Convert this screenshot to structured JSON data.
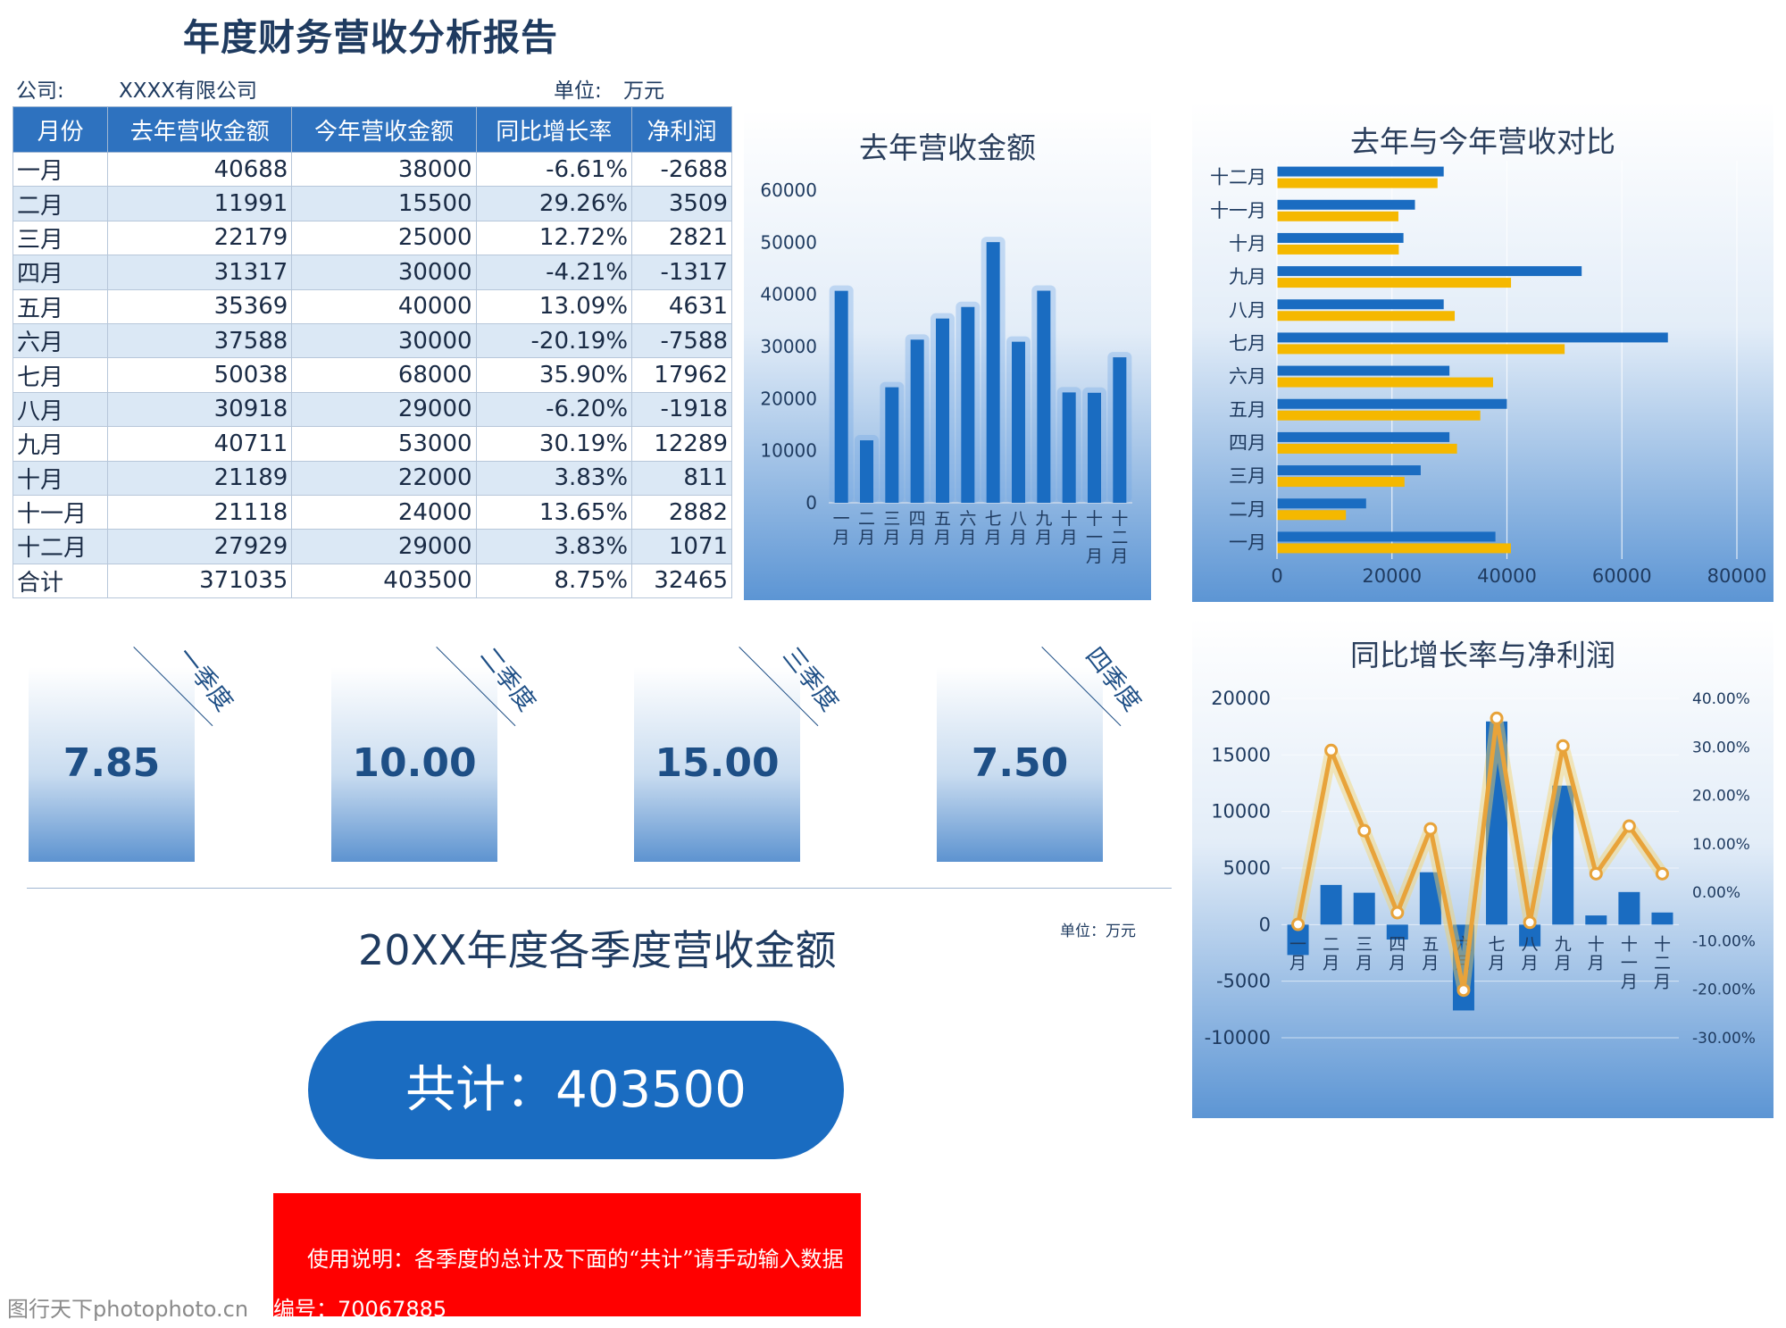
{
  "report": {
    "title": "年度财务营收分析报告",
    "company_label": "公司:",
    "company_value": "XXXX有限公司",
    "unit_label": "单位:",
    "unit_value": "万元"
  },
  "table": {
    "headers": [
      "月份",
      "去年营收金额",
      "今年营收金额",
      "同比增长率",
      "净利润"
    ],
    "rows": [
      [
        "一月",
        "40688",
        "38000",
        "-6.61%",
        "-2688"
      ],
      [
        "二月",
        "11991",
        "15500",
        "29.26%",
        "3509"
      ],
      [
        "三月",
        "22179",
        "25000",
        "12.72%",
        "2821"
      ],
      [
        "四月",
        "31317",
        "30000",
        "-4.21%",
        "-1317"
      ],
      [
        "五月",
        "35369",
        "40000",
        "13.09%",
        "4631"
      ],
      [
        "六月",
        "37588",
        "30000",
        "-20.19%",
        "-7588"
      ],
      [
        "七月",
        "50038",
        "68000",
        "35.90%",
        "17962"
      ],
      [
        "八月",
        "30918",
        "29000",
        "-6.20%",
        "-1918"
      ],
      [
        "九月",
        "40711",
        "53000",
        "30.19%",
        "12289"
      ],
      [
        "十月",
        "21189",
        "22000",
        "3.83%",
        "811"
      ],
      [
        "十一月",
        "21118",
        "24000",
        "13.65%",
        "2882"
      ],
      [
        "十二月",
        "27929",
        "29000",
        "3.83%",
        "1071"
      ],
      [
        "合计",
        "371035",
        "403500",
        "8.75%",
        "32465"
      ]
    ]
  },
  "quarters": [
    {
      "label": "一季度",
      "value": "7.85"
    },
    {
      "label": "二季度",
      "value": "10.00"
    },
    {
      "label": "三季度",
      "value": "15.00"
    },
    {
      "label": "四季度",
      "value": "7.50"
    }
  ],
  "quarter_section": {
    "title": "20XX年度各季度营收金额",
    "unit": "单位：万元",
    "total_text": "共计：403500"
  },
  "note": {
    "text": "使用说明：各季度的总计及下面的“共计”请手动输入数据"
  },
  "watermark": {
    "site": "图行天下photophoto.cn",
    "id_text": "编号：70067885"
  },
  "colors": {
    "dark_blue": "#1a6cc1",
    "header_blue": "#2e72bf",
    "gold": "#f5b800",
    "line_orange": "#e8a33a",
    "red": "#ff0000"
  },
  "chart_data": [
    {
      "type": "bar",
      "title": "去年营收金额",
      "categories": [
        "一月",
        "二月",
        "三月",
        "四月",
        "五月",
        "六月",
        "七月",
        "八月",
        "九月",
        "十月",
        "十一月",
        "十二月"
      ],
      "values": [
        40688,
        11991,
        22179,
        31317,
        35369,
        37588,
        50038,
        30918,
        40711,
        21189,
        21118,
        27929
      ],
      "yticks": [
        "60000",
        "50000",
        "40000",
        "30000",
        "20000",
        "10000",
        "0"
      ],
      "ylim": [
        0,
        60000
      ],
      "grid": false
    },
    {
      "type": "bar",
      "orientation": "horizontal",
      "title": "去年与今年营收对比",
      "categories": [
        "十二月",
        "十一月",
        "十月",
        "九月",
        "八月",
        "七月",
        "六月",
        "五月",
        "四月",
        "三月",
        "二月",
        "一月"
      ],
      "series": [
        {
          "values": [
            29000,
            24000,
            22000,
            53000,
            29000,
            68000,
            30000,
            40000,
            30000,
            25000,
            15500,
            38000
          ],
          "color": "#1a6cc1"
        },
        {
          "values": [
            27929,
            21118,
            21189,
            40711,
            30918,
            50038,
            37588,
            35369,
            31317,
            22179,
            11991,
            40688
          ],
          "color": "#f5b800"
        }
      ],
      "xticks": [
        "0",
        "20000",
        "40000",
        "60000",
        "80000"
      ],
      "xlim": [
        0,
        80000
      ],
      "grid": true
    },
    {
      "type": "bar",
      "combo": "bar+line",
      "title": "同比增长率与净利润",
      "categories": [
        "一月",
        "二月",
        "三月",
        "四月",
        "五月",
        "六月",
        "七月",
        "八月",
        "九月",
        "十月",
        "十一月",
        "十二月"
      ],
      "series": [
        {
          "type": "bar",
          "axis": "left",
          "values": [
            -2688,
            3509,
            2821,
            -1317,
            4631,
            -7588,
            17962,
            -1918,
            12289,
            811,
            2882,
            1071
          ]
        },
        {
          "type": "line",
          "axis": "right",
          "values": [
            -6.61,
            29.26,
            12.72,
            -4.21,
            13.09,
            -20.19,
            35.9,
            -6.2,
            30.19,
            3.83,
            13.65,
            3.83
          ]
        }
      ],
      "yticks_left": [
        "20000",
        "15000",
        "10000",
        "5000",
        "0",
        "-5000",
        "-10000"
      ],
      "yticks_right": [
        "40.00%",
        "30.00%",
        "20.00%",
        "10.00%",
        "0.00%",
        "-10.00%",
        "-20.00%",
        "-30.00%"
      ],
      "ylim_left": [
        -10000,
        20000
      ],
      "ylim_right": [
        -30,
        40
      ],
      "grid": true
    }
  ]
}
